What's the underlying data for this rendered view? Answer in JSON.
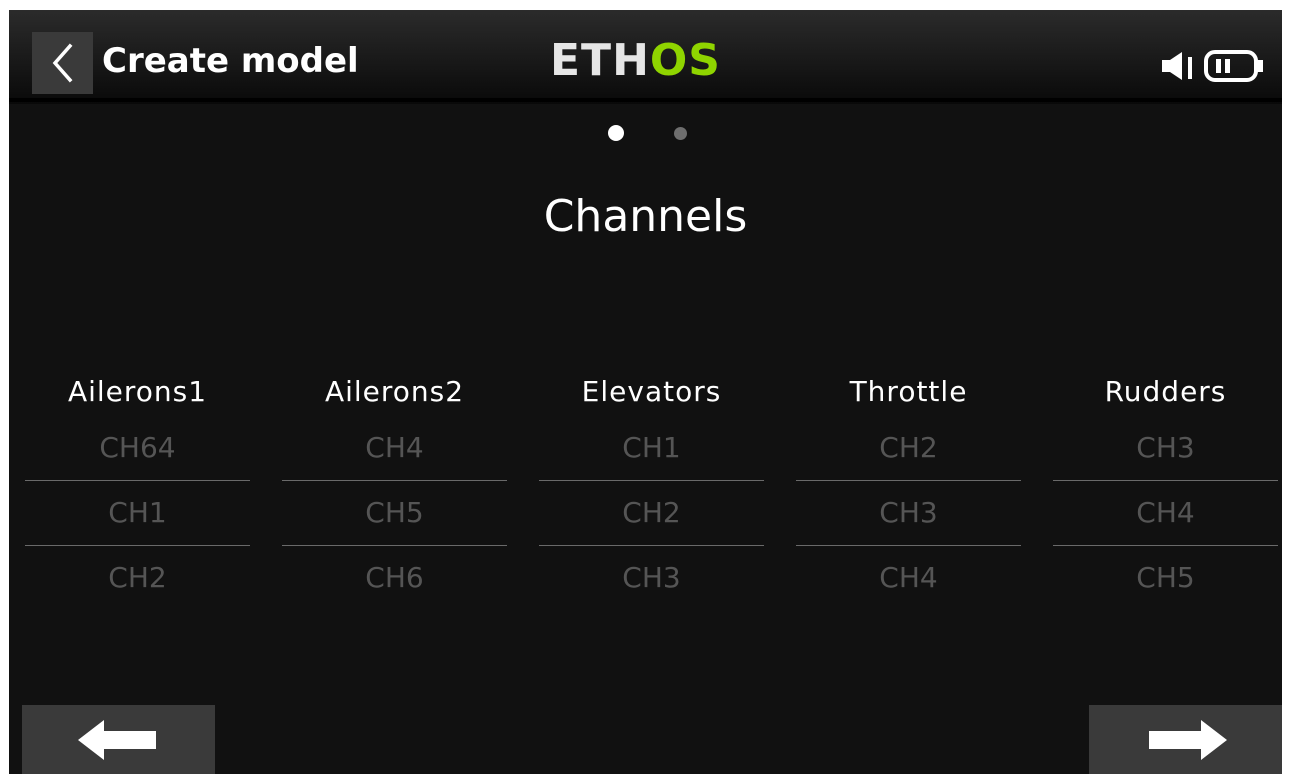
{
  "header": {
    "back_icon": "chevron-left-icon",
    "title": "Create model",
    "logo_part1": "ETH",
    "logo_part2": "OS",
    "logo_accent_color": "#8fd400",
    "status_icons": [
      "speaker-icon",
      "battery-icon"
    ]
  },
  "pager": {
    "total": 2,
    "active": 1
  },
  "page": {
    "title": "Channels"
  },
  "columns": [
    {
      "label": "Ailerons1",
      "options": [
        "CH64",
        "CH1",
        "CH2"
      ]
    },
    {
      "label": "Ailerons2",
      "options": [
        "CH4",
        "CH5",
        "CH6"
      ]
    },
    {
      "label": "Elevators",
      "options": [
        "CH1",
        "CH2",
        "CH3"
      ]
    },
    {
      "label": "Throttle",
      "options": [
        "CH2",
        "CH3",
        "CH4"
      ]
    },
    {
      "label": "Rudders",
      "options": [
        "CH3",
        "CH4",
        "CH5"
      ]
    }
  ],
  "footer": {
    "prev_icon": "arrow-left-icon",
    "next_icon": "arrow-right-icon"
  }
}
